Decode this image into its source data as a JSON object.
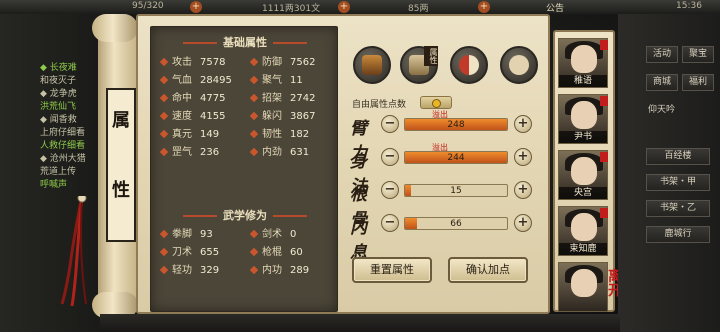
{
  "top_bar": {
    "counter": "95/320",
    "currency_money": "1111两301文",
    "currency_liang": "85两",
    "notice": "公告",
    "time": "15:36"
  },
  "left_panel": {
    "lines": [
      "◆ 长夜难",
      "和夜灭子",
      "◆ 龙争虎",
      "洪荒仙飞",
      "◆ 闻香救",
      "上府仔细看",
      "人救仔细看",
      "◆ 沧州大猎",
      "荒道上传",
      "呼喊声"
    ]
  },
  "scroll": {
    "title_chars": [
      "属",
      "性"
    ]
  },
  "base_attributes": {
    "header": "基础属性",
    "rows": [
      [
        {
          "label": "攻击",
          "value": "7578"
        },
        {
          "label": "防御",
          "value": "7562"
        }
      ],
      [
        {
          "label": "气血",
          "value": "28495"
        },
        {
          "label": "聚气",
          "value": "11"
        }
      ],
      [
        {
          "label": "命中",
          "value": "4775"
        },
        {
          "label": "招架",
          "value": "2742"
        }
      ],
      [
        {
          "label": "速度",
          "value": "4155"
        },
        {
          "label": "躲闪",
          "value": "3867"
        }
      ],
      [
        {
          "label": "真元",
          "value": "149"
        },
        {
          "label": "韧性",
          "value": "182"
        }
      ],
      [
        {
          "label": "罡气",
          "value": "236"
        },
        {
          "label": "内劲",
          "value": "631"
        }
      ]
    ]
  },
  "martial_skills": {
    "header": "武学修为",
    "rows": [
      [
        {
          "label": "拳脚",
          "value": "93"
        },
        {
          "label": "剑术",
          "value": "0"
        }
      ],
      [
        {
          "label": "刀术",
          "value": "655"
        },
        {
          "label": "枪棍",
          "value": "60"
        }
      ],
      [
        {
          "label": "轻功",
          "value": "329"
        },
        {
          "label": "内功",
          "value": "289"
        }
      ]
    ]
  },
  "tab_icons": [
    "hat-icon",
    "scroll-bag-icon",
    "yin-yang-icon",
    "body-icon"
  ],
  "tab_icon_badge": "属性",
  "free_points_label": "自由属性点数",
  "attributes": [
    {
      "label": "臂力",
      "value": "248",
      "overflow": "溢出",
      "fill": 1.0
    },
    {
      "label": "身法",
      "value": "244",
      "overflow": "溢出",
      "fill": 1.0
    },
    {
      "label": "根骨",
      "value": "15",
      "overflow": "",
      "fill": 0.06
    },
    {
      "label": "内息",
      "value": "66",
      "overflow": "",
      "fill": 0.12
    }
  ],
  "buttons": {
    "reset": "重置属性",
    "confirm": "确认加点"
  },
  "party": [
    {
      "name": "稚语"
    },
    {
      "name": "尹书"
    },
    {
      "name": "央宫"
    },
    {
      "name": "束知鹿"
    },
    {
      "name": ""
    }
  ],
  "leave_label": "离开",
  "right_menu": {
    "row1": [
      "活动",
      "聚宝"
    ],
    "row2": [
      "商城",
      "福利"
    ],
    "player": "仰天吟",
    "items": [
      "百经楼",
      "书架・甲",
      "书架・乙",
      "鹿城行"
    ]
  },
  "colors": {
    "accent_red": "#c9562d",
    "overflow_red": "#c01c12",
    "bar_orange": "#f08c2c"
  }
}
